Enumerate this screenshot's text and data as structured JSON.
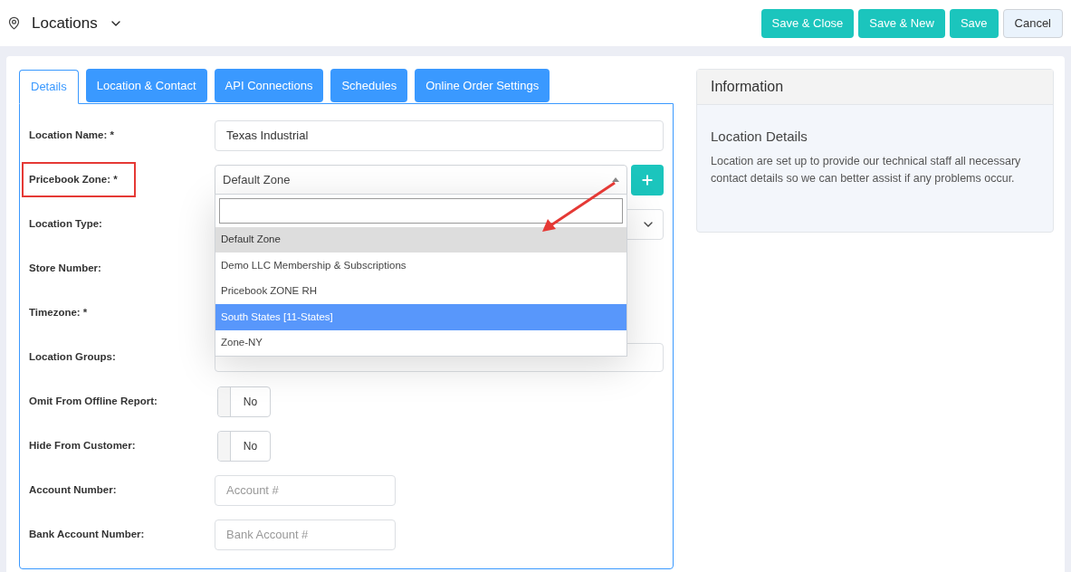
{
  "header": {
    "title": "Locations",
    "buttons": [
      {
        "label": "Save & Close",
        "kind": "primary"
      },
      {
        "label": "Save & New",
        "kind": "primary"
      },
      {
        "label": "Save",
        "kind": "primary"
      },
      {
        "label": "Cancel",
        "kind": "secondary"
      }
    ]
  },
  "tabs": [
    {
      "label": "Details",
      "selected": true
    },
    {
      "label": "Location & Contact",
      "selected": false
    },
    {
      "label": "API Connections",
      "selected": false
    },
    {
      "label": "Schedules",
      "selected": false
    },
    {
      "label": "Online Order Settings",
      "selected": false
    }
  ],
  "fields": [
    {
      "label": "Location Name: *",
      "kind": "text",
      "value": "Texas Industrial",
      "highlighted": false
    },
    {
      "label": "Pricebook Zone: *",
      "kind": "dropdown",
      "value": "Default Zone",
      "highlighted": true,
      "arrow_annotation": true,
      "options": [
        {
          "label": "Default Zone",
          "selected": true,
          "hovered": false
        },
        {
          "label": "Demo LLC Membership & Subscriptions",
          "selected": false,
          "hovered": false
        },
        {
          "label": "Pricebook ZONE RH",
          "selected": false,
          "hovered": false
        },
        {
          "label": "South States [11-States]",
          "selected": false,
          "hovered": true
        },
        {
          "label": "Zone-NY",
          "selected": false,
          "hovered": false
        }
      ]
    },
    {
      "label": "Location Type:",
      "kind": "select",
      "highlighted": false
    },
    {
      "label": "Store Number:",
      "kind": "hidden",
      "highlighted": false
    },
    {
      "label": "Timezone: *",
      "kind": "hidden",
      "highlighted": false
    },
    {
      "label": "Location Groups:",
      "kind": "covered",
      "highlighted": false
    },
    {
      "label": "Omit From Offline Report:",
      "kind": "toggle",
      "on": false,
      "value": "No",
      "highlighted": false
    },
    {
      "label": "Hide From Customer:",
      "kind": "toggle",
      "on": false,
      "value": "No",
      "highlighted": false
    },
    {
      "label": "Account Number:",
      "kind": "short",
      "placeholder": "Account #",
      "highlighted": false
    },
    {
      "label": "Bank Account Number:",
      "kind": "short",
      "placeholder": "Bank Account #",
      "highlighted": false
    }
  ],
  "info": {
    "title": "Information",
    "heading": "Location Details",
    "text": "Location are set up to provide our technical staff all necessary contact details so we can better assist if any problems occur."
  }
}
